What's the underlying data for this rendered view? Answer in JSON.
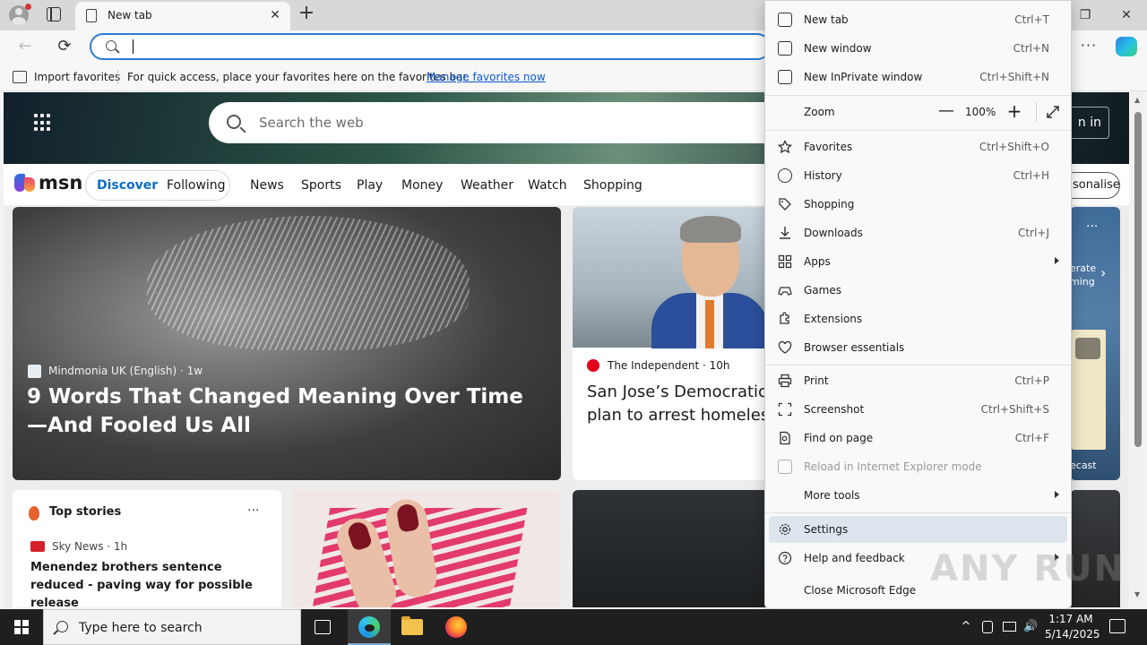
{
  "browser": {
    "tab_title": "New tab",
    "tab_close_glyph": "✕",
    "new_tab_glyph": "+",
    "window_controls": {
      "minimize": "—",
      "restore": "❐",
      "close": "✕"
    },
    "back_glyph": "←",
    "reload_glyph": "⟳",
    "more_glyph": "···",
    "address_value": "",
    "favorites_bar": {
      "import_label": "Import favorites",
      "hint_text": "For quick access, place your favorites here on the favorites bar.",
      "manage_link": "Manage favorites now"
    }
  },
  "msn": {
    "search_placeholder": "Search the web",
    "signin_fragment": "n in",
    "logo_text": "msn",
    "tabs": {
      "discover": "Discover",
      "following": "Following"
    },
    "nav_links": [
      "News",
      "Sports",
      "Play",
      "Money",
      "Weather",
      "Watch",
      "Shopping"
    ],
    "personalise_fragment": "sonalise",
    "main_card": {
      "source": "Mindmonia UK (English) · 1w",
      "headline": "9 Words That Changed Meaning Over Time—And Fooled Us All"
    },
    "second_card": {
      "source": "The Independent · 10h",
      "headline": "San Jose’s Democratic mayor defends plan to arrest homeless people who"
    },
    "weather_card": {
      "dots": "···",
      "text1": "erate",
      "text2": "ming",
      "chevron": "›",
      "footer": "ecast"
    },
    "top_stories": {
      "title": "Top stories",
      "dots": "···",
      "source": "Sky News · 1h",
      "headline": "Menendez brothers sentence reduced - paving way for possible release"
    }
  },
  "menu": {
    "items": [
      {
        "label": "New tab",
        "shortcut": "Ctrl+T"
      },
      {
        "label": "New window",
        "shortcut": "Ctrl+N"
      },
      {
        "label": "New InPrivate window",
        "shortcut": "Ctrl+Shift+N"
      },
      {
        "label": "Zoom",
        "value": "100%",
        "minus": "—",
        "plus": "+"
      },
      {
        "label": "Favorites",
        "shortcut": "Ctrl+Shift+O"
      },
      {
        "label": "History",
        "shortcut": "Ctrl+H"
      },
      {
        "label": "Shopping",
        "shortcut": ""
      },
      {
        "label": "Downloads",
        "shortcut": "Ctrl+J"
      },
      {
        "label": "Apps",
        "shortcut": ""
      },
      {
        "label": "Games",
        "shortcut": ""
      },
      {
        "label": "Extensions",
        "shortcut": ""
      },
      {
        "label": "Browser essentials",
        "shortcut": ""
      },
      {
        "label": "Print",
        "shortcut": "Ctrl+P"
      },
      {
        "label": "Screenshot",
        "shortcut": "Ctrl+Shift+S"
      },
      {
        "label": "Find on page",
        "shortcut": "Ctrl+F"
      },
      {
        "label": "Reload in Internet Explorer mode",
        "shortcut": ""
      },
      {
        "label": "More tools",
        "shortcut": ""
      },
      {
        "label": "Settings",
        "shortcut": ""
      },
      {
        "label": "Help and feedback",
        "shortcut": ""
      },
      {
        "label": "Close Microsoft Edge",
        "shortcut": ""
      }
    ]
  },
  "watermark": "ANY RUN",
  "taskbar": {
    "search_placeholder": "Type here to search",
    "time": "1:17 AM",
    "date": "5/14/2025",
    "tray_glyphs": {
      "chevron": "^",
      "volume": "🔊"
    }
  },
  "scrollbar": {
    "up_glyph": "▲",
    "down_glyph": "▼"
  },
  "colors": {
    "accent": "#2b7cd3",
    "menu_highlight": "#dde5ee",
    "msn_blue": "#0f6cbd"
  }
}
